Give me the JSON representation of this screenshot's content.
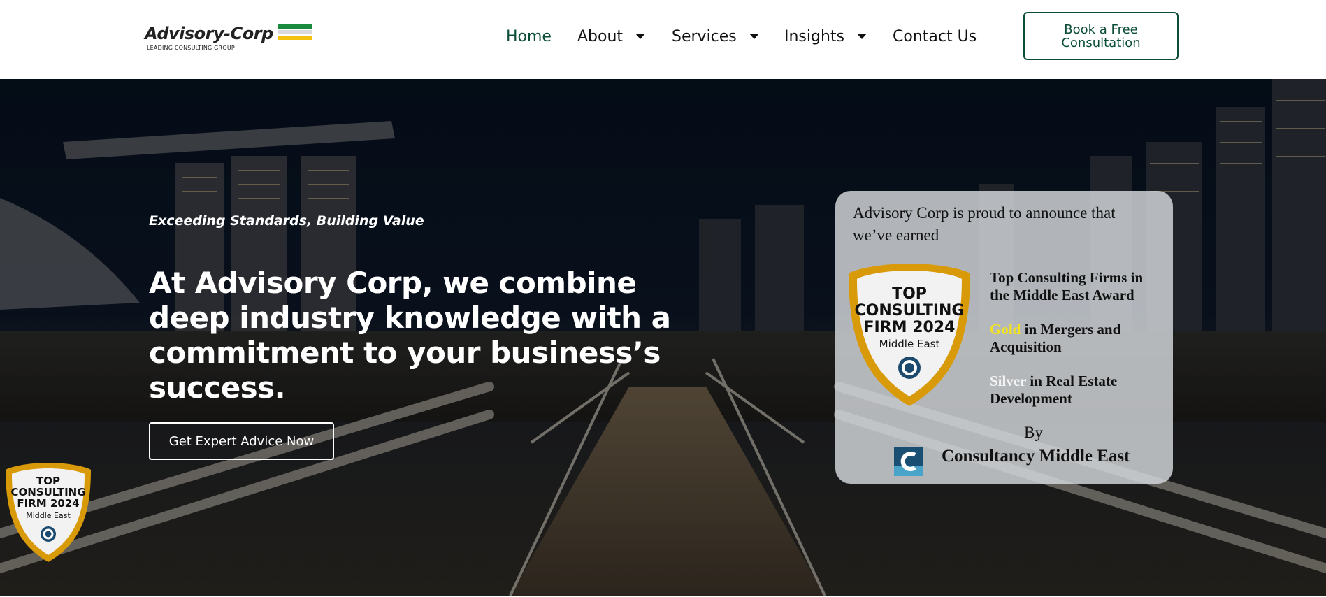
{
  "logo": {
    "name": "Advisory-Corp",
    "tagline": "LEADING CONSULTING GROUP",
    "bar_colors": [
      "#1a8a3e",
      "#d9d9d9",
      "#f4c20d"
    ]
  },
  "nav": {
    "items": [
      {
        "label": "Home",
        "active": true,
        "has_caret": false
      },
      {
        "label": "About",
        "active": false,
        "has_caret": true
      },
      {
        "label": "Services",
        "active": false,
        "has_caret": true
      },
      {
        "label": "Insights",
        "active": false,
        "has_caret": true
      },
      {
        "label": "Contact Us",
        "active": false,
        "has_caret": false
      }
    ],
    "cta_label": "Book a Free Consultation"
  },
  "hero": {
    "tagline": "Exceeding Standards, Building Value",
    "headline": "At Advisory Corp, we combine deep industry knowledge with a commitment to your business’s success.",
    "button_label": "Get Expert Advice Now"
  },
  "award_card": {
    "intro": "Advisory Corp is proud to announce that we’ve earned",
    "line1": "Top Consulting Firms in the Middle East Award",
    "line2_highlight": "Gold",
    "line2_rest": " in Mergers and Acquisition",
    "line3_highlight": "Silver",
    "line3_rest": " in Real Estate Development",
    "by": "By",
    "org": "Consultancy Middle East"
  },
  "badge": {
    "line1": "TOP",
    "line2": "CONSULTING",
    "line3": "FIRM 2024",
    "region": "Middle East"
  },
  "colors": {
    "brand_green": "#0b4d37",
    "active_nav": "#0b4d37",
    "gold_text": "#f2e31c",
    "badge_gold": "#e0a800"
  }
}
